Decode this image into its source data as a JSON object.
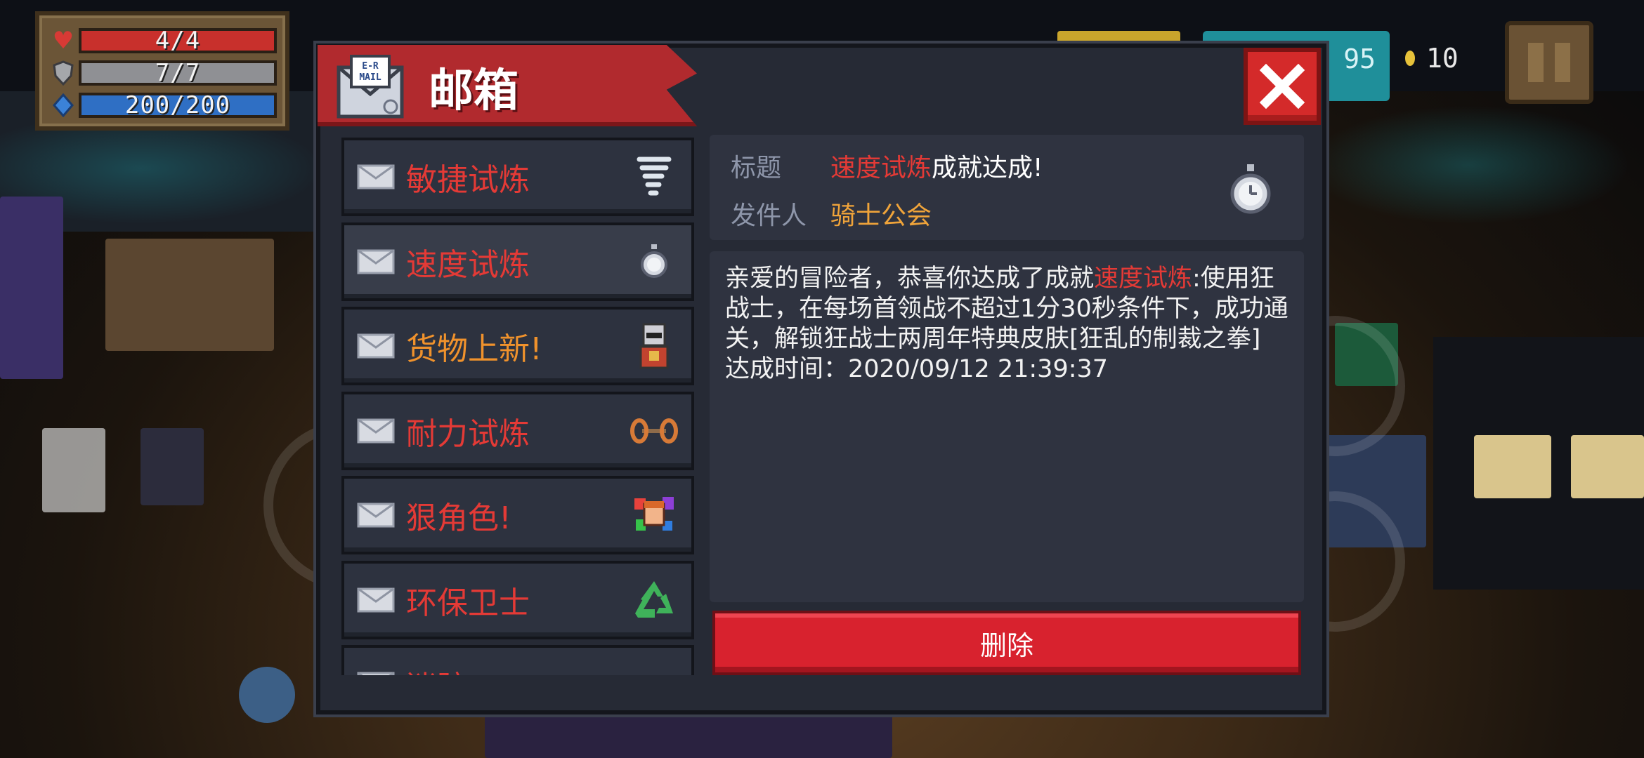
{
  "hud": {
    "health": "4/4",
    "armor": "7/7",
    "energy": "200/200",
    "gems": "95",
    "coins": "10"
  },
  "mailbox": {
    "title": "邮箱",
    "mail_icon_text": "E-R MAIL",
    "items": [
      {
        "label": "敏捷试炼",
        "color": "red",
        "thumb": "tornado-icon"
      },
      {
        "label": "速度试炼",
        "color": "red",
        "thumb": "stopwatch-icon"
      },
      {
        "label": "货物上新!",
        "color": "orange",
        "thumb": "merchant-icon"
      },
      {
        "label": "耐力试炼",
        "color": "red",
        "thumb": "dumbbell-icon"
      },
      {
        "label": "狠角色!",
        "color": "red",
        "thumb": "character-icon"
      },
      {
        "label": "环保卫士",
        "color": "red",
        "thumb": "recycle-icon"
      },
      {
        "label": "迷踪.。",
        "color": "red",
        "thumb": "blue-item-icon"
      }
    ],
    "selected_index": 1,
    "detail": {
      "subject_key": "标题",
      "subject_highlight": "速度试炼",
      "subject_rest": "成就达成!",
      "sender_key": "发件人",
      "sender": "骑士公会",
      "body_part1": "亲爱的冒险者，恭喜你达成了成就",
      "body_highlight": "速度试炼",
      "body_part2": ":使用狂战士，在每场首领战不超过1分30秒条件下，成功通关，解锁狂战士两周年特典皮肤[狂乱的制裁之拳]",
      "achieved_line": "达成时间：2020/09/12 21:39:37"
    },
    "delete_label": "删除"
  },
  "colors": {
    "accent_red": "#e43a36",
    "accent_orange": "#f0922c",
    "panel": "#262a35",
    "sender_color": "#f0a43a"
  }
}
